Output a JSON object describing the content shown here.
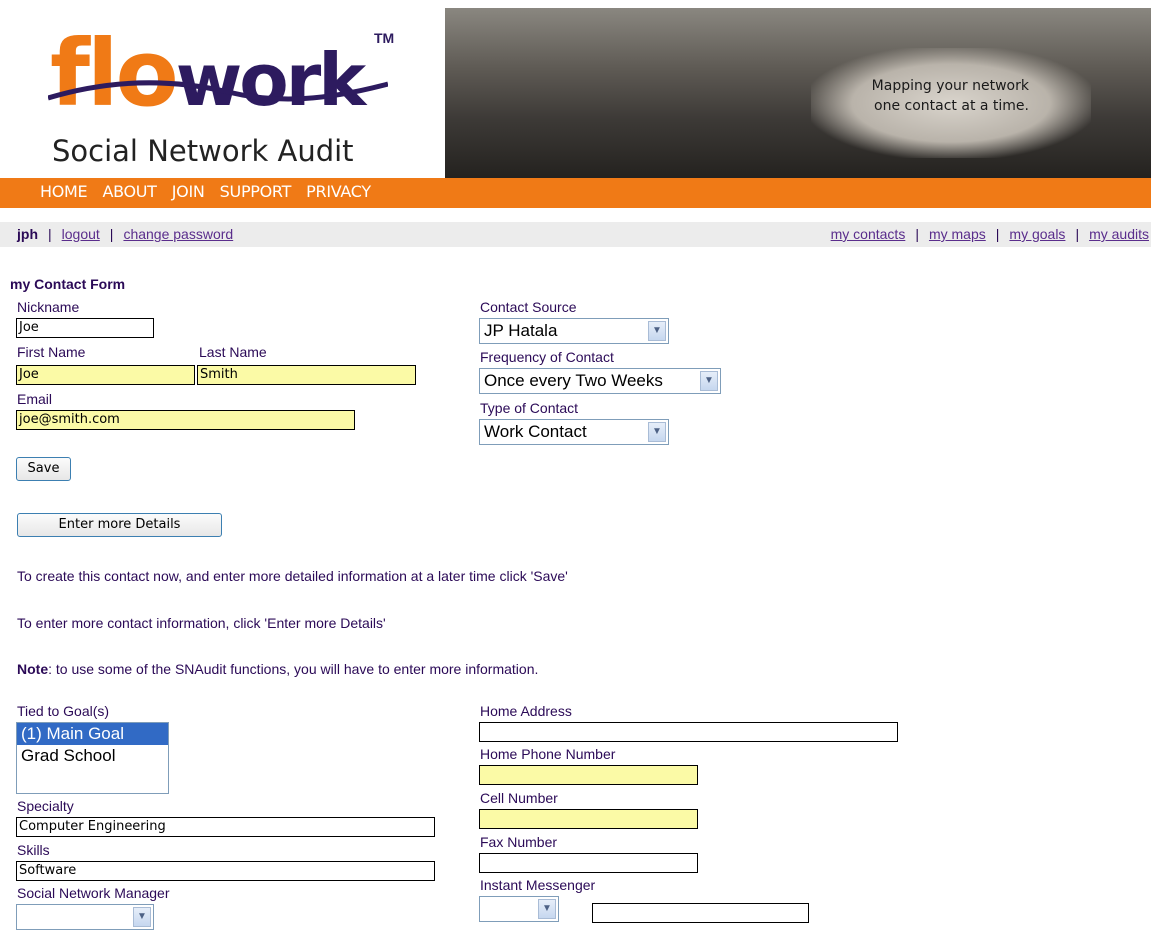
{
  "brand": {
    "logo_text_fl": "flo",
    "logo_text_ork": "work",
    "logo_tm": "TM",
    "logo_subtitle": "Social Network Audit",
    "banner_line1": "Mapping your network",
    "banner_line2": "one contact at a time.",
    "accent_color": "#f07a16",
    "logo_dark_color": "#2d1b5f"
  },
  "topnav": [
    "HOME",
    "ABOUT",
    "JOIN",
    "SUPPORT",
    "PRIVACY"
  ],
  "userbar": {
    "username": "jph",
    "logout": "logout",
    "change_password": "change password",
    "links": [
      "my contacts",
      "my maps",
      "my goals",
      "my audits"
    ]
  },
  "form": {
    "title": "my Contact Form",
    "nickname_label": "Nickname",
    "nickname_value": "Joe",
    "first_name_label": "First Name",
    "first_name_value": "Joe",
    "last_name_label": "Last Name",
    "last_name_value": "Smith",
    "email_label": "Email",
    "email_value": "joe@smith.com",
    "contact_source_label": "Contact Source",
    "contact_source_value": "JP Hatala",
    "frequency_label": "Frequency of Contact",
    "frequency_value": "Once every Two Weeks",
    "type_label": "Type of Contact",
    "type_value": "Work Contact",
    "save_button": "Save",
    "more_details_button": "Enter more Details",
    "msg_save": "To create this contact now, and enter more detailed information at a later time click 'Save'",
    "msg_details": "To enter more contact information, click 'Enter more Details'",
    "note_bold": "Note",
    "note_text": ": to use some of the SNAudit functions, you will have to enter more information."
  },
  "details": {
    "goals_label": "Tied to Goal(s)",
    "goals_options": [
      "(1) Main Goal",
      "Grad School"
    ],
    "goals_selected": "(1) Main Goal",
    "specialty_label": "Specialty",
    "specialty_value": "Computer Engineering",
    "skills_label": "Skills",
    "skills_value": "Software",
    "sn_manager_label": "Social Network Manager",
    "home_address_label": "Home Address",
    "home_address_value": "",
    "home_phone_label": "Home Phone Number",
    "home_phone_value": "",
    "cell_label": "Cell Number",
    "cell_value": "",
    "fax_label": "Fax Number",
    "fax_value": "",
    "im_label": "Instant Messenger",
    "im_value": ""
  }
}
